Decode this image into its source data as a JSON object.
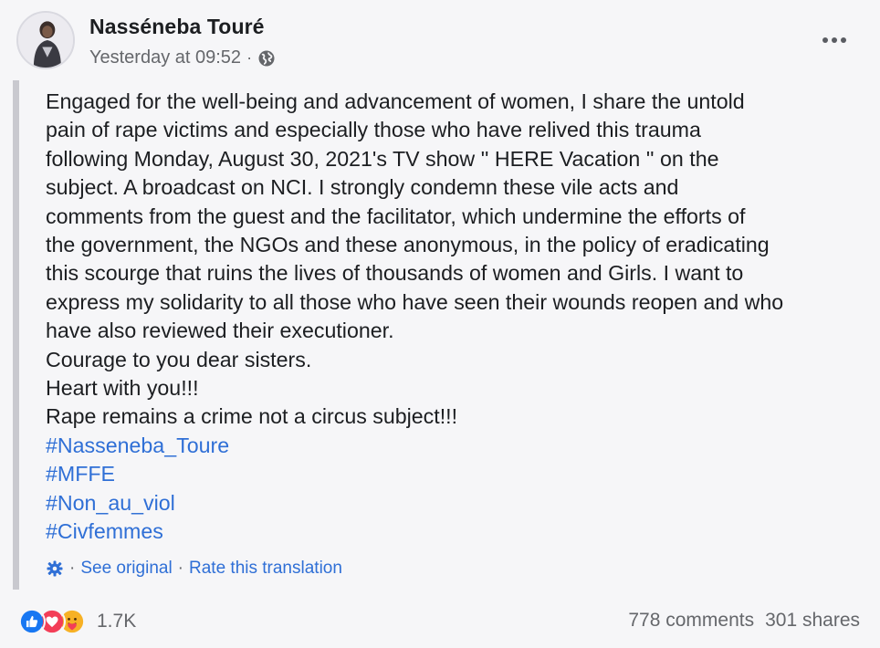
{
  "post": {
    "author": "Nasséneba Touré",
    "timestamp": "Yesterday at 09:52",
    "separator": "·",
    "privacy_icon": "globe-icon",
    "more_icon": "ellipsis-icon",
    "body_lines": [
      "Engaged for the well-being and advancement of women, I share the untold",
      "pain of rape victims and especially those who have relived this trauma",
      "following Monday, August 30, 2021's TV show '' HERE Vacation '' on the",
      "subject. A broadcast on NCI. I strongly condemn these vile acts and",
      "comments from the guest and the facilitator, which undermine the efforts of",
      "the government, the NGOs and these anonymous, in the policy of eradicating",
      "this scourge that ruins the lives of thousands of women and Girls. I want to",
      "express my solidarity to all those who have seen their wounds reopen and who",
      "have also reviewed their executioner.",
      "Courage to you dear sisters.",
      "Heart with you!!!",
      "Rape remains a crime not a circus subject!!!"
    ],
    "hashtags": [
      "#Nasseneba_Toure",
      "#MFFE",
      "#Non_au_viol",
      "#Civfemmes"
    ]
  },
  "translation": {
    "separator": "·",
    "see_original": "See original",
    "rate_translation": "Rate this translation"
  },
  "footer": {
    "reactions": [
      "like",
      "love",
      "care"
    ],
    "reaction_count": "1.7K",
    "comments": "778 comments",
    "shares": "301 shares"
  },
  "colors": {
    "link": "#2f6fd6",
    "like": "#1877f2",
    "love": "#f33e58",
    "care": "#f7b125"
  }
}
